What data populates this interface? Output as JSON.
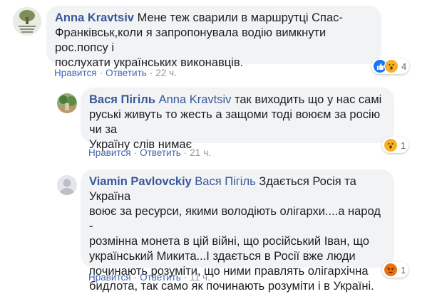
{
  "colors": {
    "link": "#385898",
    "action": "#4267b2",
    "bubble": "#f2f3f5",
    "muted": "#90949c"
  },
  "comments": [
    {
      "author": "Anna Kravtsiv",
      "mention": "",
      "lines": [
        "Мене теж сварили в маршрутці Спас-",
        "Франківськ,коли я запропонувала водію вимкнути рос.попсу і",
        "послухати українських виконавців."
      ],
      "like": "Нравится",
      "reply": "Ответить",
      "time": "22 ч.",
      "reactions": [
        "like-icon",
        "wow-icon"
      ],
      "reaction_count": "4"
    },
    {
      "author": "Вася Пігіль",
      "mention": "Anna Kravtsiv",
      "lines": [
        "так виходить що у нас самі",
        "руські живуть то жесть а защоми тоді воюєм за росію чи за",
        "Україну слів нимає"
      ],
      "like": "Нравится",
      "reply": "Ответить",
      "time": "21 ч.",
      "reactions": [
        "wow-icon"
      ],
      "reaction_count": "1"
    },
    {
      "author": "Viamin Pavlovckiy",
      "mention": "Вася Пігіль",
      "lines": [
        "Здається Росія та Україна",
        "воює за ресурси, якими володіють олігархи....а народ -",
        "розмінна монета в цій війні, що російський Іван, що",
        "український Микита...І здається в Росії вже люди",
        "починають розуміти, що ними правлять олігархічна",
        "бидлота, так само як починають розуміти і в Україні."
      ],
      "like": "Нравится",
      "reply": "Ответить",
      "time": "11 ч.",
      "reactions": [
        "angry-icon"
      ],
      "reaction_count": "1"
    }
  ]
}
